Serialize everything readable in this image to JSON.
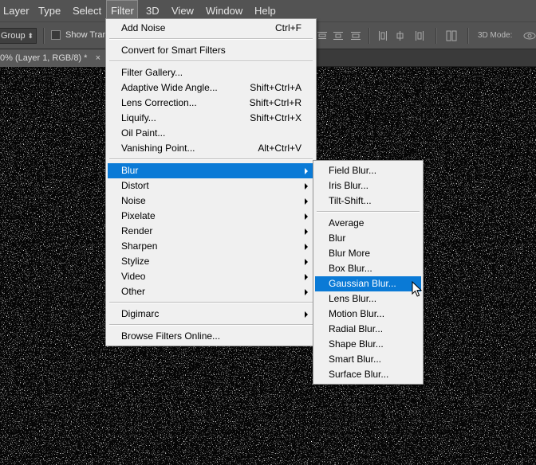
{
  "menubar": {
    "items": [
      "Layer",
      "Type",
      "Select",
      "Filter",
      "3D",
      "View",
      "Window",
      "Help"
    ],
    "active_index": 3
  },
  "options_bar": {
    "auto_select_value": "Group",
    "show_transform_label": "Show Trans",
    "mode_3d_label": "3D Mode:"
  },
  "document_tab": {
    "title": "0% (Layer 1, RGB/8) *",
    "close_glyph": "×"
  },
  "filter_menu": {
    "items": [
      {
        "label": "Add Noise",
        "shortcut": "Ctrl+F"
      },
      {
        "separator": true
      },
      {
        "label": "Convert for Smart Filters"
      },
      {
        "separator": true
      },
      {
        "label": "Filter Gallery..."
      },
      {
        "label": "Adaptive Wide Angle...",
        "shortcut": "Shift+Ctrl+A"
      },
      {
        "label": "Lens Correction...",
        "shortcut": "Shift+Ctrl+R"
      },
      {
        "label": "Liquify...",
        "shortcut": "Shift+Ctrl+X"
      },
      {
        "label": "Oil Paint..."
      },
      {
        "label": "Vanishing Point...",
        "shortcut": "Alt+Ctrl+V"
      },
      {
        "separator": true
      },
      {
        "label": "Blur",
        "submenu": true,
        "highlighted": true
      },
      {
        "label": "Distort",
        "submenu": true
      },
      {
        "label": "Noise",
        "submenu": true
      },
      {
        "label": "Pixelate",
        "submenu": true
      },
      {
        "label": "Render",
        "submenu": true
      },
      {
        "label": "Sharpen",
        "submenu": true
      },
      {
        "label": "Stylize",
        "submenu": true
      },
      {
        "label": "Video",
        "submenu": true
      },
      {
        "label": "Other",
        "submenu": true
      },
      {
        "separator": true
      },
      {
        "label": "Digimarc",
        "submenu": true
      },
      {
        "separator": true
      },
      {
        "label": "Browse Filters Online..."
      }
    ]
  },
  "blur_submenu": {
    "items": [
      {
        "label": "Field Blur..."
      },
      {
        "label": "Iris Blur..."
      },
      {
        "label": "Tilt-Shift..."
      },
      {
        "separator": true
      },
      {
        "label": "Average"
      },
      {
        "label": "Blur"
      },
      {
        "label": "Blur More"
      },
      {
        "label": "Box Blur..."
      },
      {
        "label": "Gaussian Blur...",
        "highlighted": true
      },
      {
        "label": "Lens Blur..."
      },
      {
        "label": "Motion Blur..."
      },
      {
        "label": "Radial Blur..."
      },
      {
        "label": "Shape Blur..."
      },
      {
        "label": "Smart Blur..."
      },
      {
        "label": "Surface Blur..."
      }
    ]
  },
  "colors": {
    "highlight": "#0a7ad6",
    "menu_bg": "#f0f0f0",
    "chrome": "#535353"
  }
}
